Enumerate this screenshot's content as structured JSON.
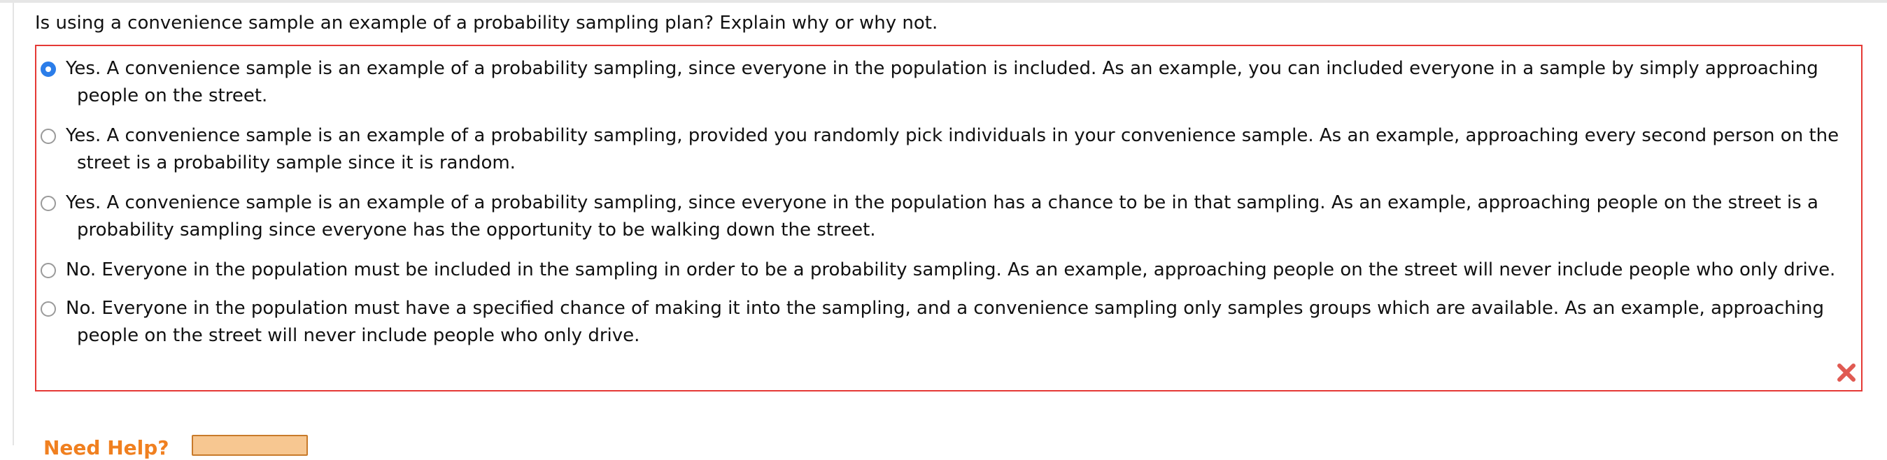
{
  "question": {
    "text": "Is using a convenience sample an example of a probability sampling plan? Explain why or why not."
  },
  "options": [
    {
      "label": "Yes. A convenience sample is an example of a probability sampling, since everyone in the population is included. As an example, you can included everyone in a sample by simply approaching people on the street.",
      "selected": true
    },
    {
      "label": "Yes. A convenience sample is an example of a probability sampling, provided you randomly pick individuals in your convenience sample. As an example, approaching every second person on the street is a probability sample since it is random.",
      "selected": false
    },
    {
      "label": "Yes. A convenience sample is an example of a probability sampling, since everyone in the population has a chance to be in that sampling. As an example, approaching people on the street is a probability sampling since everyone has the opportunity to be walking down the street.",
      "selected": false
    },
    {
      "label": "No. Everyone in the population must be included in the sampling in order to be a probability sampling. As an example, approaching people on the street will never include people who only drive.",
      "selected": false
    },
    {
      "label": "No. Everyone in the population must have a specified chance of making it into the sampling, and a convenience sampling only samples groups which are available. As an example, approaching people on the street will never include people who only drive.",
      "selected": false
    }
  ],
  "feedback": {
    "status": "incorrect",
    "icon": "x-icon",
    "color": "#e05a52"
  },
  "help": {
    "label": "Need Help?"
  },
  "colors": {
    "answer_border": "#e53935",
    "radio_selected": "#2b7de9",
    "help_text": "#f08020",
    "help_button": "#f7c791"
  }
}
